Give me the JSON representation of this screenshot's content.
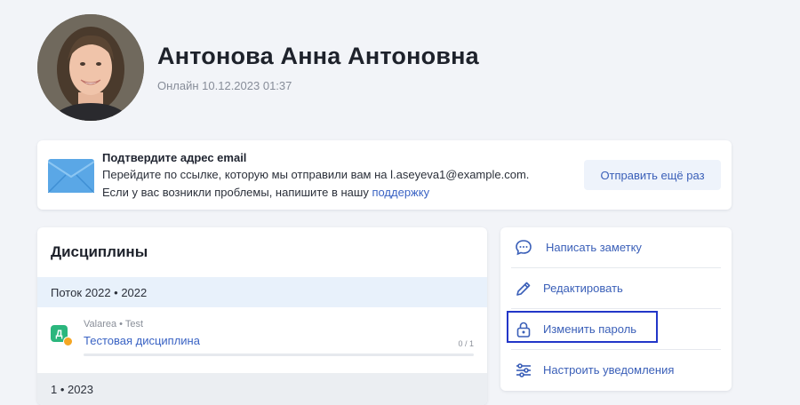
{
  "profile": {
    "name": "Антонова Анна Антоновна",
    "status": "Онлайн 10.12.2023 01:37"
  },
  "email_notice": {
    "title": "Подтвердите адрес email",
    "line1": "Перейдите по ссылке, которую мы отправили вам на l.aseyeva1@example.com.",
    "line2_prefix": "Если у вас возникли проблемы, напишите в нашу ",
    "line2_link": "поддержку",
    "resend_label": "Отправить ещё раз",
    "icon": "envelope-icon"
  },
  "disciplines": {
    "title": "Дисциплины",
    "groups": [
      {
        "header": "Поток 2022 • 2022",
        "items": [
          {
            "badge": "Д",
            "org": "Valarea • Test",
            "name": "Тестовая дисциплина",
            "progress_text": "0 / 1",
            "progress": 0
          }
        ]
      },
      {
        "header": "1 • 2023"
      }
    ]
  },
  "actions": [
    {
      "label": "Написать заметку",
      "icon": "chat-bubble-icon"
    },
    {
      "label": "Редактировать",
      "icon": "pencil-icon"
    },
    {
      "label": "Изменить пароль",
      "icon": "lock-icon",
      "highlighted": true
    },
    {
      "label": "Настроить уведомления",
      "icon": "sliders-icon"
    }
  ],
  "colors": {
    "accent": "#3a5fb8",
    "link": "#3a63c4",
    "badge": "#2bb67d",
    "highlight_border": "#2236c8",
    "background": "#f2f4f8"
  }
}
